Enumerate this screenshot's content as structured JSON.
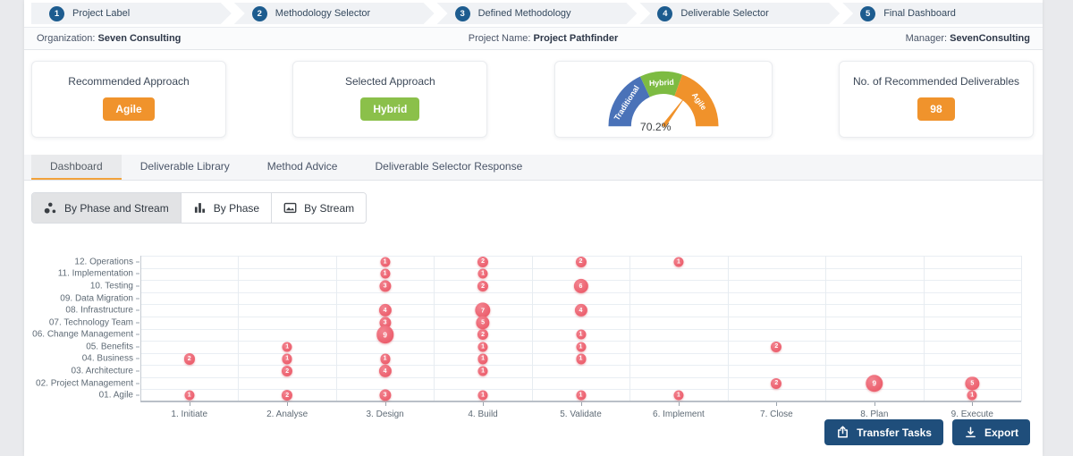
{
  "stepper": {
    "steps": [
      {
        "num": "1",
        "label": "Project Label"
      },
      {
        "num": "2",
        "label": "Methodology Selector"
      },
      {
        "num": "3",
        "label": "Defined Methodology"
      },
      {
        "num": "4",
        "label": "Deliverable Selector"
      },
      {
        "num": "5",
        "label": "Final Dashboard"
      }
    ],
    "circle_color": "#1d5c8f"
  },
  "info_bar": {
    "org_label": "Organization:",
    "org_value": "Seven Consulting",
    "project_label": "Project Name:",
    "project_value": "Project Pathfinder",
    "manager_label": "Manager:",
    "manager_value": "SevenConsulting"
  },
  "cards": {
    "recommended": {
      "title": "Recommended Approach",
      "badge": "Agile",
      "badge_color": "#f0932c"
    },
    "selected": {
      "title": "Selected Approach",
      "badge": "Hybrid",
      "badge_color": "#8bc04a"
    },
    "gauge": {
      "value_label": "70.2%",
      "value_pct": 70.2,
      "needle_color": "#f0922b",
      "segments": [
        {
          "label": "Traditional",
          "color": "#4a72b8",
          "from_deg": 180,
          "to_deg": 115
        },
        {
          "label": "Hybrid",
          "color": "#7dbb42",
          "from_deg": 115,
          "to_deg": 70
        },
        {
          "label": "Agile",
          "color": "#f0922b",
          "from_deg": 70,
          "to_deg": 0
        }
      ]
    },
    "deliverables": {
      "title": "No. of Recommended Deliverables",
      "badge": "98",
      "badge_color": "#f0932c"
    }
  },
  "tabs": [
    {
      "label": "Dashboard",
      "active": true
    },
    {
      "label": "Deliverable Library",
      "active": false
    },
    {
      "label": "Method Advice",
      "active": false
    },
    {
      "label": "Deliverable Selector Response",
      "active": false
    }
  ],
  "tab_accent_color": "#f2a23b",
  "view_toggle": [
    {
      "label": "By Phase and Stream",
      "icon": "bubble-chart-icon",
      "active": true
    },
    {
      "label": "By Phase",
      "icon": "bar-chart-icon",
      "active": false
    },
    {
      "label": "By Stream",
      "icon": "image-icon",
      "active": false
    }
  ],
  "chart_data": {
    "type": "scatter",
    "bubble_color": "#ed5f69",
    "x_categories": [
      "1. Initiate",
      "2. Analyse",
      "3. Design",
      "4. Build",
      "5. Validate",
      "6. Implement",
      "7. Close",
      "8. Plan",
      "9. Execute"
    ],
    "y_categories_top_down": [
      "12. Operations",
      "11. Implementation",
      "10. Testing",
      "09. Data Migration",
      "08. Infrastructure",
      "07. Technology Team",
      "06. Change Management",
      "05. Benefits",
      "04. Business",
      "03. Architecture",
      "02. Project Management",
      "01. Agile"
    ],
    "points": [
      {
        "y": "12. Operations",
        "x": "3. Design",
        "value": 1
      },
      {
        "y": "12. Operations",
        "x": "4. Build",
        "value": 2
      },
      {
        "y": "12. Operations",
        "x": "5. Validate",
        "value": 2
      },
      {
        "y": "12. Operations",
        "x": "6. Implement",
        "value": 1
      },
      {
        "y": "11. Implementation",
        "x": "3. Design",
        "value": 1
      },
      {
        "y": "11. Implementation",
        "x": "4. Build",
        "value": 1
      },
      {
        "y": "10. Testing",
        "x": "3. Design",
        "value": 3
      },
      {
        "y": "10. Testing",
        "x": "4. Build",
        "value": 2
      },
      {
        "y": "10. Testing",
        "x": "5. Validate",
        "value": 6
      },
      {
        "y": "08. Infrastructure",
        "x": "3. Design",
        "value": 4
      },
      {
        "y": "08. Infrastructure",
        "x": "4. Build",
        "value": 7
      },
      {
        "y": "08. Infrastructure",
        "x": "5. Validate",
        "value": 4
      },
      {
        "y": "07. Technology Team",
        "x": "3. Design",
        "value": 3
      },
      {
        "y": "07. Technology Team",
        "x": "4. Build",
        "value": 5
      },
      {
        "y": "06. Change Management",
        "x": "3. Design",
        "value": 9
      },
      {
        "y": "06. Change Management",
        "x": "4. Build",
        "value": 2
      },
      {
        "y": "06. Change Management",
        "x": "5. Validate",
        "value": 1
      },
      {
        "y": "05. Benefits",
        "x": "2. Analyse",
        "value": 1
      },
      {
        "y": "05. Benefits",
        "x": "4. Build",
        "value": 1
      },
      {
        "y": "05. Benefits",
        "x": "5. Validate",
        "value": 1
      },
      {
        "y": "05. Benefits",
        "x": "7. Close",
        "value": 2
      },
      {
        "y": "04. Business",
        "x": "1. Initiate",
        "value": 2
      },
      {
        "y": "04. Business",
        "x": "2. Analyse",
        "value": 1
      },
      {
        "y": "04. Business",
        "x": "3. Design",
        "value": 1
      },
      {
        "y": "04. Business",
        "x": "4. Build",
        "value": 1
      },
      {
        "y": "04. Business",
        "x": "5. Validate",
        "value": 1
      },
      {
        "y": "03. Architecture",
        "x": "2. Analyse",
        "value": 2
      },
      {
        "y": "03. Architecture",
        "x": "3. Design",
        "value": 4
      },
      {
        "y": "03. Architecture",
        "x": "4. Build",
        "value": 1
      },
      {
        "y": "02. Project Management",
        "x": "7. Close",
        "value": 2
      },
      {
        "y": "02. Project Management",
        "x": "8. Plan",
        "value": 9
      },
      {
        "y": "02. Project Management",
        "x": "9. Execute",
        "value": 5
      },
      {
        "y": "01. Agile",
        "x": "1. Initiate",
        "value": 1
      },
      {
        "y": "01. Agile",
        "x": "2. Analyse",
        "value": 2
      },
      {
        "y": "01. Agile",
        "x": "3. Design",
        "value": 3
      },
      {
        "y": "01. Agile",
        "x": "4. Build",
        "value": 1
      },
      {
        "y": "01. Agile",
        "x": "5. Validate",
        "value": 1
      },
      {
        "y": "01. Agile",
        "x": "6. Implement",
        "value": 1
      },
      {
        "y": "01. Agile",
        "x": "9. Execute",
        "value": 1
      }
    ]
  },
  "footer": {
    "transfer_label": "Transfer Tasks",
    "export_label": "Export",
    "button_color": "#1f4e7b"
  }
}
